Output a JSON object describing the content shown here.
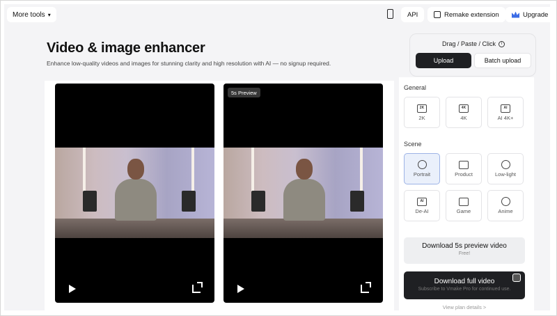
{
  "topbar": {
    "more_tools": "More tools",
    "api": "API",
    "remake_extension": "Remake extension",
    "upgrade": "Upgrade"
  },
  "header": {
    "title": "Video & image enhancer",
    "subtitle": "Enhance low-quality videos and images for stunning clarity and high resolution with AI — no signup required."
  },
  "upload": {
    "hint": "Drag / Paste / Click",
    "upload_label": "Upload",
    "batch_label": "Batch upload"
  },
  "preview": {
    "badge": "5s Preview"
  },
  "settings": {
    "general_label": "General",
    "general_options": [
      {
        "icon_text": "2K",
        "label": "2K"
      },
      {
        "icon_text": "4K",
        "label": "4K"
      },
      {
        "icon_text": "AI",
        "label": "AI 4K+"
      }
    ],
    "scene_label": "Scene",
    "scene_options": [
      {
        "label": "Portrait",
        "selected": true
      },
      {
        "label": "Product",
        "selected": false
      },
      {
        "label": "Low-light",
        "selected": false
      },
      {
        "icon_text": "AI",
        "label": "De-AI",
        "selected": false
      },
      {
        "label": "Game",
        "selected": false
      },
      {
        "label": "Anime",
        "selected": false
      }
    ],
    "download_preview": {
      "title": "Download 5s preview video",
      "note": "Free!"
    },
    "download_full": {
      "title": "Download full video",
      "note": "Subscribe to Vmake Pro for continued use."
    },
    "plan_link": "View plan details >"
  },
  "colors": {
    "accent_dark": "#1f2023",
    "selected_bg": "#eaf0fb",
    "upgrade_icon": "#3b6ce6"
  }
}
